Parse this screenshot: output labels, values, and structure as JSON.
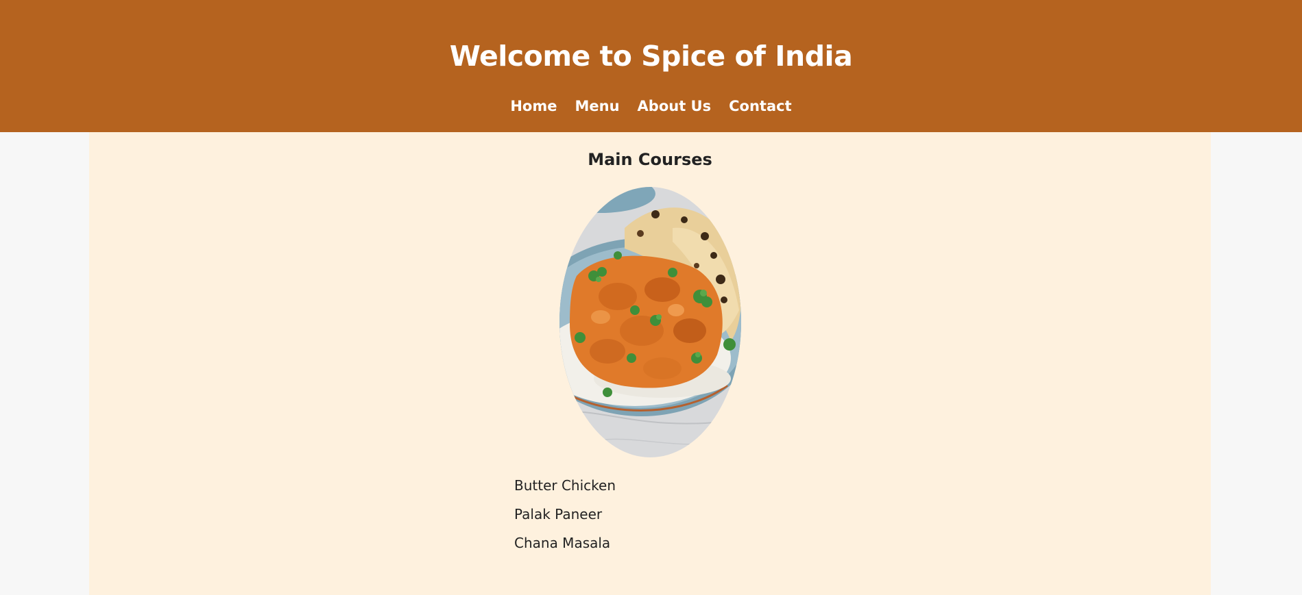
{
  "header": {
    "title": "Welcome to Spice of India",
    "background_color": "#b5631f",
    "nav": [
      {
        "label": "Home"
      },
      {
        "label": "Menu"
      },
      {
        "label": "About Us"
      },
      {
        "label": "Contact"
      }
    ]
  },
  "main": {
    "background_color": "#fef1de",
    "section_title": "Main Courses",
    "image": {
      "icon": "butter-chicken-photo"
    },
    "dishes": [
      {
        "name": "Butter Chicken"
      },
      {
        "name": "Palak Paneer"
      },
      {
        "name": "Chana Masala"
      }
    ]
  }
}
